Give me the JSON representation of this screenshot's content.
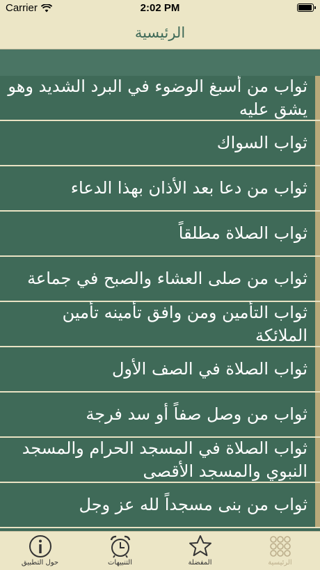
{
  "status_bar": {
    "carrier": "Carrier",
    "time": "2:02 PM",
    "battery_level": 0.95
  },
  "nav": {
    "title": "الرئيسية"
  },
  "items": [
    {
      "label": "ثواب من أسبغ الوضوء في البرد الشديد وهو يشق عليه"
    },
    {
      "label": "ثواب السواك"
    },
    {
      "label": "ثواب من دعا بعد الأذان بهذا الدعاء"
    },
    {
      "label": "ثواب الصلاة مطلقاً"
    },
    {
      "label": "ثواب من صلى العشاء والصبح في جماعة"
    },
    {
      "label": "ثواب التأمين ومن وافق تأمينه تأمين الملائكة"
    },
    {
      "label": "ثواب الصلاة في الصف الأول"
    },
    {
      "label": "ثواب من وصل صفاً أو سد فرجة"
    },
    {
      "label": "ثواب الصلاة في المسجد الحرام والمسجد النبوي والمسجد الأقصى"
    },
    {
      "label": "ثواب من بنى مسجداً لله عز وجل"
    }
  ],
  "tabs": [
    {
      "label": "حول التطبيق",
      "icon": "info-icon"
    },
    {
      "label": "التنبيهات",
      "icon": "alarm-clock-icon"
    },
    {
      "label": "المفضلة",
      "icon": "star-icon"
    },
    {
      "label": "الرئيسية",
      "icon": "grid-dots-icon"
    }
  ],
  "colors": {
    "background": "#3f6a58",
    "bar": "#ece6c6",
    "accent": "#b9a97a",
    "active_tab": "#bcae8c"
  }
}
